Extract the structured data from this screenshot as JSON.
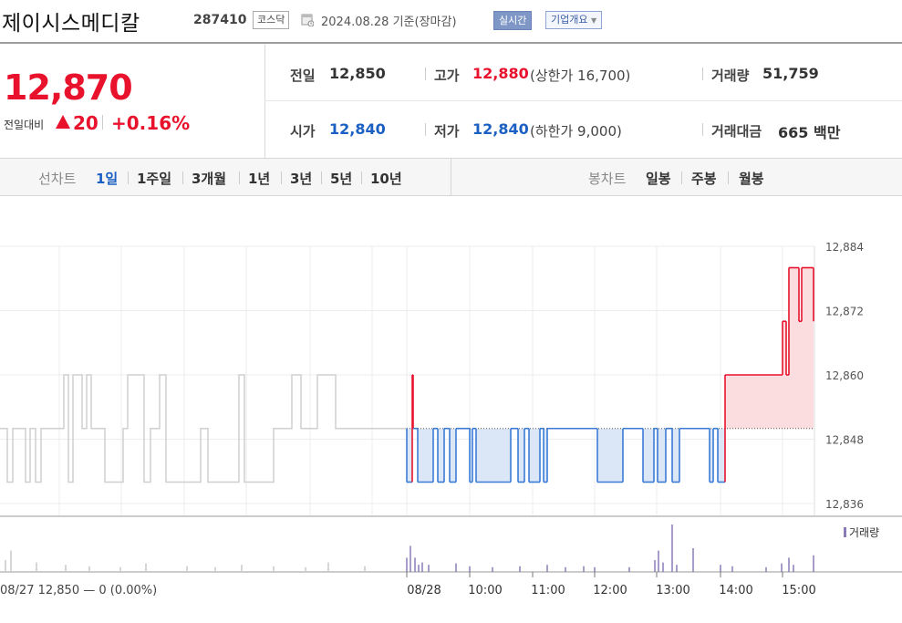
{
  "header": {
    "company": "제이시스메디칼",
    "code": "287410",
    "market": "코스닥",
    "date": "2024.08.28",
    "date_suffix": "기준(장마감)",
    "realtime": "실시간",
    "company_overview": "기업개요"
  },
  "quote": {
    "price": "12,870",
    "change_label": "전일대비",
    "change_amount": "20",
    "change_percent": "+0.16%",
    "prev_close_label": "전일",
    "prev_close": "12,850",
    "high_label": "고가",
    "high": "12,880",
    "upper_limit_label": "(상한가",
    "upper_limit": "16,700)",
    "volume_label": "거래량",
    "volume": "51,759",
    "open_label": "시가",
    "open": "12,840",
    "low_label": "저가",
    "low": "12,840",
    "lower_limit_label": "(하한가",
    "lower_limit": "9,000)",
    "value_label": "거래대금",
    "value": "665",
    "value_unit": "백만"
  },
  "tabs": {
    "line_label": "선차트",
    "periods": [
      "1일",
      "1주일",
      "3개월",
      "1년",
      "3년",
      "5년",
      "10년"
    ],
    "active": "1일",
    "candle_label": "봉차트",
    "candle": [
      "일봉",
      "주봉",
      "월봉"
    ]
  },
  "colors": {
    "up": "#e8122d",
    "down": "#1a5fc1",
    "accent": "#3b5ea8"
  },
  "chart_data": {
    "type": "line",
    "y_ticks": [
      "12,884",
      "12,872",
      "12,860",
      "12,848",
      "12,836"
    ],
    "x_ticks": [
      "08/28",
      "10:00",
      "11:00",
      "12:00",
      "13:00",
      "14:00",
      "15:00"
    ],
    "prev_label": "08/27  12,850 — 0 (0.00%)",
    "volume_label": "거래량",
    "baseline": 12850,
    "ylim": [
      12836,
      12884
    ],
    "prev_day": [
      [
        0,
        12850
      ],
      [
        8,
        12850
      ],
      [
        8,
        12840
      ],
      [
        14,
        12840
      ],
      [
        14,
        12850
      ],
      [
        28,
        12850
      ],
      [
        28,
        12840
      ],
      [
        33,
        12840
      ],
      [
        33,
        12850
      ],
      [
        39,
        12850
      ],
      [
        39,
        12840
      ],
      [
        45,
        12840
      ],
      [
        45,
        12850
      ],
      [
        70,
        12850
      ],
      [
        70,
        12860
      ],
      [
        75,
        12860
      ],
      [
        75,
        12840
      ],
      [
        80,
        12840
      ],
      [
        80,
        12860
      ],
      [
        90,
        12860
      ],
      [
        90,
        12850
      ],
      [
        95,
        12850
      ],
      [
        95,
        12860
      ],
      [
        100,
        12860
      ],
      [
        100,
        12850
      ],
      [
        115,
        12850
      ],
      [
        115,
        12840
      ],
      [
        135,
        12840
      ],
      [
        135,
        12850
      ],
      [
        140,
        12850
      ],
      [
        140,
        12860
      ],
      [
        158,
        12860
      ],
      [
        158,
        12840
      ],
      [
        165,
        12840
      ],
      [
        165,
        12850
      ],
      [
        175,
        12850
      ],
      [
        175,
        12860
      ],
      [
        182,
        12860
      ],
      [
        182,
        12840
      ],
      [
        220,
        12840
      ],
      [
        220,
        12850
      ],
      [
        228,
        12850
      ],
      [
        228,
        12840
      ],
      [
        262,
        12840
      ],
      [
        262,
        12860
      ],
      [
        268,
        12860
      ],
      [
        268,
        12840
      ],
      [
        300,
        12840
      ],
      [
        300,
        12850
      ],
      [
        320,
        12850
      ],
      [
        320,
        12860
      ],
      [
        330,
        12860
      ],
      [
        330,
        12850
      ],
      [
        348,
        12850
      ],
      [
        348,
        12860
      ],
      [
        368,
        12860
      ],
      [
        368,
        12850
      ],
      [
        446,
        12850
      ]
    ],
    "today": [
      [
        446,
        12850
      ],
      [
        446,
        12840
      ],
      [
        452,
        12840
      ],
      [
        452,
        12860
      ],
      [
        453,
        12860
      ],
      [
        453,
        12850
      ],
      [
        458,
        12850
      ],
      [
        458,
        12840
      ],
      [
        475,
        12840
      ],
      [
        475,
        12850
      ],
      [
        480,
        12850
      ],
      [
        480,
        12840
      ],
      [
        487,
        12840
      ],
      [
        487,
        12850
      ],
      [
        493,
        12850
      ],
      [
        493,
        12840
      ],
      [
        500,
        12840
      ],
      [
        500,
        12850
      ],
      [
        515,
        12850
      ],
      [
        515,
        12840
      ],
      [
        518,
        12840
      ],
      [
        518,
        12850
      ],
      [
        522,
        12850
      ],
      [
        522,
        12840
      ],
      [
        560,
        12840
      ],
      [
        560,
        12850
      ],
      [
        568,
        12850
      ],
      [
        568,
        12840
      ],
      [
        575,
        12840
      ],
      [
        575,
        12850
      ],
      [
        580,
        12850
      ],
      [
        580,
        12840
      ],
      [
        592,
        12840
      ],
      [
        592,
        12850
      ],
      [
        596,
        12850
      ],
      [
        596,
        12840
      ],
      [
        600,
        12840
      ],
      [
        600,
        12850
      ],
      [
        655,
        12850
      ],
      [
        655,
        12840
      ],
      [
        683,
        12840
      ],
      [
        683,
        12850
      ],
      [
        705,
        12850
      ],
      [
        705,
        12840
      ],
      [
        717,
        12840
      ],
      [
        717,
        12850
      ],
      [
        721,
        12850
      ],
      [
        721,
        12840
      ],
      [
        730,
        12840
      ],
      [
        730,
        12850
      ],
      [
        737,
        12850
      ],
      [
        737,
        12840
      ],
      [
        745,
        12840
      ],
      [
        745,
        12850
      ],
      [
        778,
        12850
      ],
      [
        778,
        12840
      ],
      [
        782,
        12840
      ],
      [
        782,
        12850
      ],
      [
        787,
        12850
      ],
      [
        787,
        12840
      ],
      [
        795,
        12840
      ],
      [
        795,
        12860
      ],
      [
        858,
        12860
      ],
      [
        858,
        12870
      ],
      [
        862,
        12870
      ],
      [
        862,
        12860
      ],
      [
        865,
        12860
      ],
      [
        865,
        12880
      ],
      [
        876,
        12880
      ],
      [
        876,
        12870
      ],
      [
        879,
        12870
      ],
      [
        879,
        12880
      ],
      [
        892,
        12880
      ],
      [
        892,
        12870
      ]
    ],
    "volume_bars": [
      [
        6,
        0.25
      ],
      [
        12,
        0.45
      ],
      [
        40,
        0.2
      ],
      [
        72,
        0.15
      ],
      [
        98,
        0.12
      ],
      [
        132,
        0.1
      ],
      [
        160,
        0.18
      ],
      [
        205,
        0.12
      ],
      [
        236,
        0.1
      ],
      [
        265,
        0.15
      ],
      [
        300,
        0.12
      ],
      [
        335,
        0.1
      ],
      [
        360,
        0.2
      ],
      [
        400,
        0.12
      ],
      [
        446,
        0.3
      ],
      [
        450,
        0.55
      ],
      [
        455,
        0.3
      ],
      [
        459,
        0.15
      ],
      [
        463,
        0.2
      ],
      [
        470,
        0.15
      ],
      [
        500,
        0.18
      ],
      [
        515,
        0.12
      ],
      [
        540,
        0.1
      ],
      [
        570,
        0.12
      ],
      [
        600,
        0.15
      ],
      [
        620,
        0.1
      ],
      [
        640,
        0.12
      ],
      [
        652,
        0.1
      ],
      [
        690,
        0.1
      ],
      [
        718,
        0.25
      ],
      [
        722,
        0.45
      ],
      [
        727,
        0.2
      ],
      [
        737,
        1.0
      ],
      [
        742,
        0.15
      ],
      [
        760,
        0.5
      ],
      [
        790,
        0.15
      ],
      [
        803,
        0.12
      ],
      [
        840,
        0.1
      ],
      [
        857,
        0.18
      ],
      [
        865,
        0.3
      ],
      [
        870,
        0.15
      ],
      [
        892,
        0.35
      ]
    ]
  }
}
